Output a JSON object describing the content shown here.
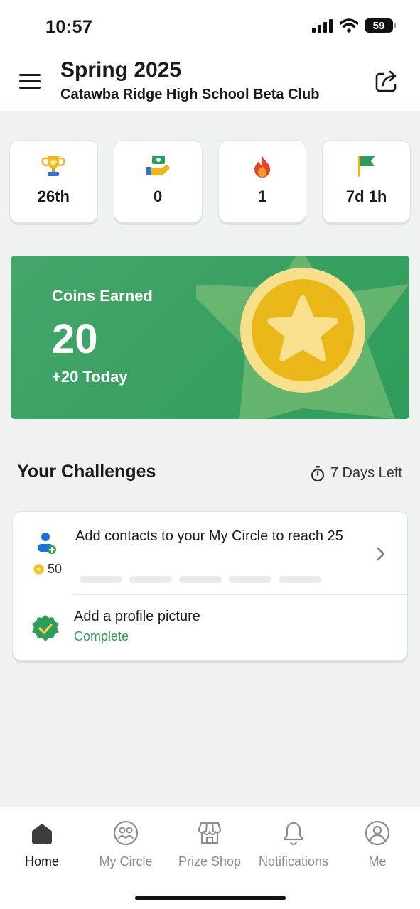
{
  "status_bar": {
    "time": "10:57",
    "battery": "59"
  },
  "header": {
    "title": "Spring 2025",
    "subtitle": "Catawba Ridge High School Beta Club",
    "menu_icon": "hamburger-menu-icon",
    "share_icon": "share-icon"
  },
  "stats": [
    {
      "icon": "trophy-icon",
      "value": "26th"
    },
    {
      "icon": "hand-money-icon",
      "value": "0"
    },
    {
      "icon": "flame-icon",
      "value": "1"
    },
    {
      "icon": "flag-icon",
      "value": "7d 1h"
    }
  ],
  "coins": {
    "label": "Coins Earned",
    "value": "20",
    "today": "+20 Today"
  },
  "challenges": {
    "title": "Your Challenges",
    "days_left": "7 Days Left",
    "items": [
      {
        "text": "Add contacts to your My Circle to reach 25",
        "reward": "50",
        "progress_total": 5,
        "progress_done": 0
      },
      {
        "text": "Add a profile picture",
        "status": "Complete"
      }
    ]
  },
  "tabs": [
    {
      "label": "Home",
      "icon": "home-icon",
      "active": true
    },
    {
      "label": "My Circle",
      "icon": "circle-faces-icon",
      "active": false
    },
    {
      "label": "Prize Shop",
      "icon": "shop-icon",
      "active": false
    },
    {
      "label": "Notifications",
      "icon": "bell-icon",
      "active": false
    },
    {
      "label": "Me",
      "icon": "user-icon",
      "active": false
    }
  ],
  "colors": {
    "brand_green": "#2e9c5a",
    "coin_gold": "#e9b818",
    "background": "#eef3f2"
  }
}
